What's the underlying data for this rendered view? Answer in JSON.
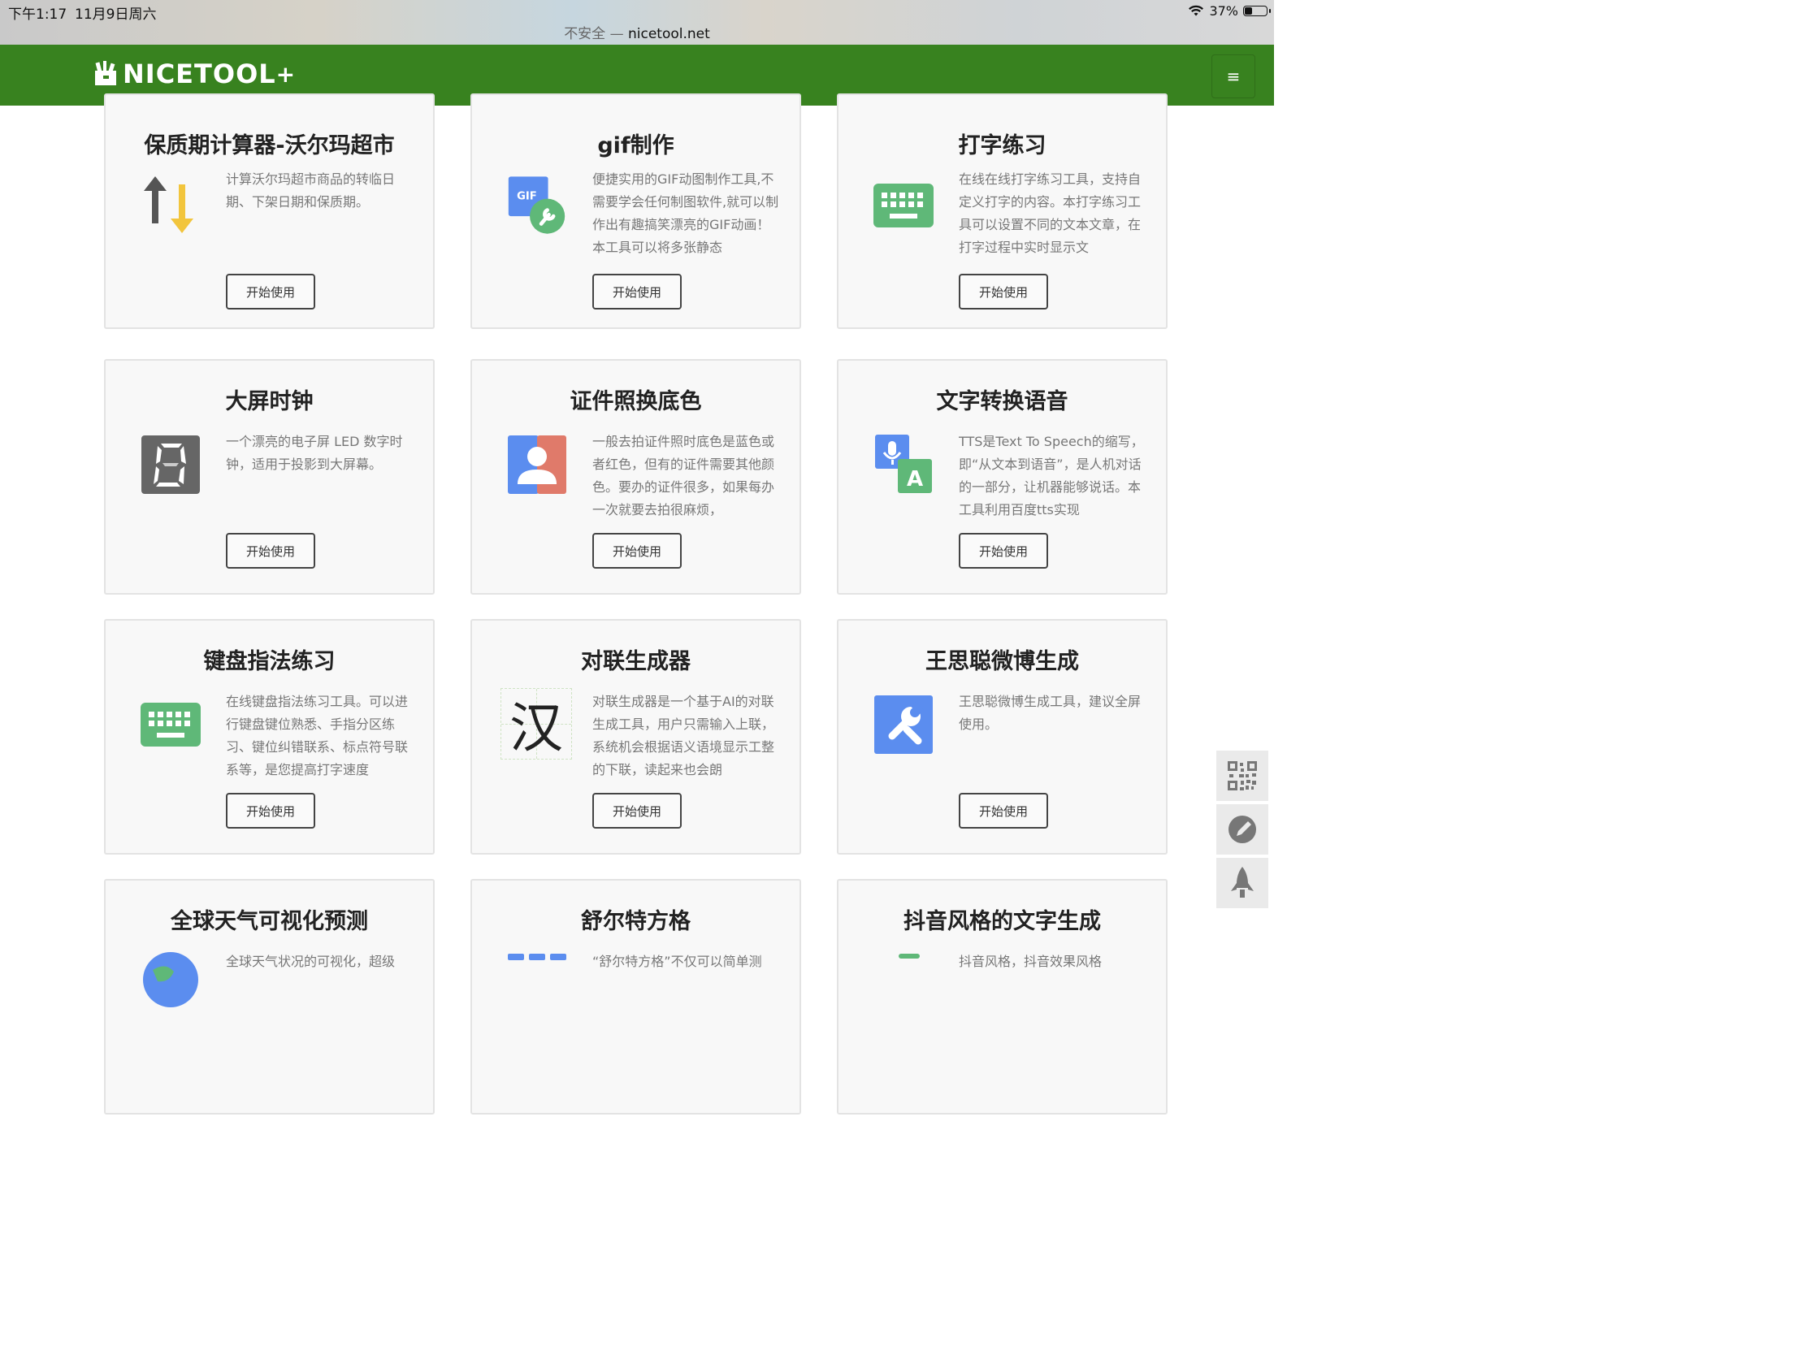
{
  "status_bar": {
    "time": "下午1:17",
    "date": "11月9日周六",
    "url_insecure": "不安全 —",
    "url_domain": "nicetool.net",
    "battery": "37%",
    "battery_level": 0.37
  },
  "navbar": {
    "brand": "NICETOOL",
    "brand_plus": "+",
    "menu_icon": "hamburger-icon",
    "brand_color": "#38821f"
  },
  "button_label": "开始使用",
  "tools": [
    {
      "title": "保质期计算器-沃尔玛超市",
      "desc": "计算沃尔玛超市商品的转临日期、下架日期和保质期。",
      "icon": "up-down-arrows-icon"
    },
    {
      "title": "gif制作",
      "desc": "便捷实用的GIF动图制作工具,不需要学会任何制图软件,就可以制作出有趣搞笑漂亮的GIF动画！本工具可以将多张静态",
      "icon": "gif-wrench-icon"
    },
    {
      "title": "打字练习",
      "desc": "在线在线打字练习工具，支持自定义打字的内容。本打字练习工具可以设置不同的文本文章，在打字过程中实时显示文",
      "icon": "keyboard-icon"
    },
    {
      "title": "大屏时钟",
      "desc": "一个漂亮的电子屏 LED 数字时钟，适用于投影到大屏幕。",
      "icon": "led-digit-icon"
    },
    {
      "title": "证件照换底色",
      "desc": "一般去拍证件照时底色是蓝色或者红色，但有的证件需要其他颜色。要办的证件很多，如果每办一次就要去拍很麻烦，",
      "icon": "id-photo-icon"
    },
    {
      "title": "文字转换语音",
      "desc": "TTS是Text To Speech的缩写，即“从文本到语音”，是人机对话的一部分，让机器能够说话。本工具利用百度tts实现",
      "icon": "mic-text-icon"
    },
    {
      "title": "键盘指法练习",
      "desc": "在线键盘指法练习工具。可以进行键盘键位熟悉、手指分区练习、键位纠错联系、标点符号联系等，是您提高打字速度",
      "icon": "keyboard-icon"
    },
    {
      "title": "对联生成器",
      "desc": "对联生成器是一个基于AI的对联生成工具，用户只需输入上联，系统机会根据语义语境显示工整的下联，读起来也会朗",
      "icon": "han-character-icon",
      "icon_char": "汉"
    },
    {
      "title": "王思聪微博生成",
      "desc": "王思聪微博生成工具，建议全屏使用。",
      "icon": "wrench-icon"
    },
    {
      "title": "全球天气可视化预测",
      "desc": "全球天气状况的可视化，超级",
      "icon": "globe-icon"
    },
    {
      "title": "舒尔特方格",
      "desc": "“舒尔特方格”不仅可以简单测",
      "icon": "grid-icon"
    },
    {
      "title": "抖音风格的文字生成",
      "desc": "抖音风格，抖音效果风格",
      "icon": "text-style-icon"
    }
  ],
  "side_tools": [
    {
      "icon": "qrcode-icon"
    },
    {
      "icon": "edit-icon"
    },
    {
      "icon": "rocket-icon"
    }
  ]
}
